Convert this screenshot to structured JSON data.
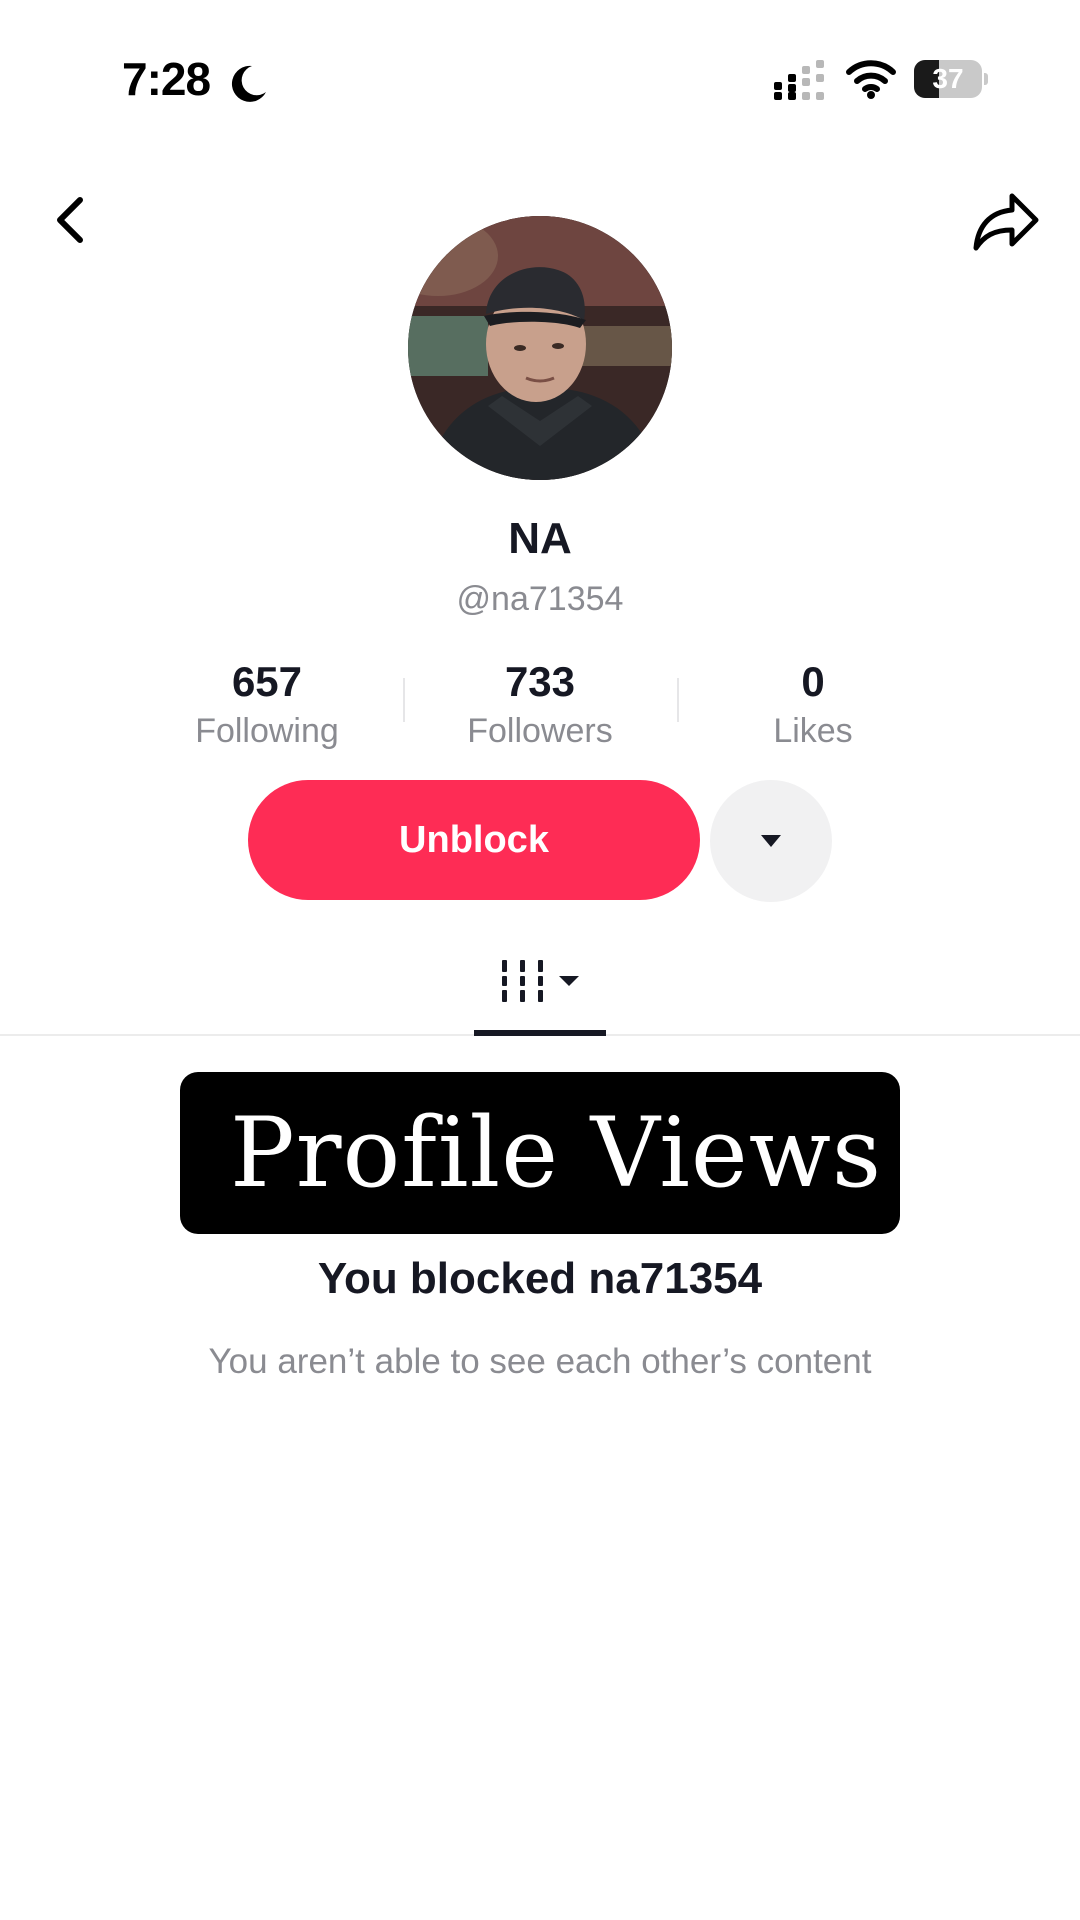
{
  "status_bar": {
    "time": "7:28",
    "battery_percent": "37",
    "battery_level": 0.37,
    "icons": [
      "moon-icon",
      "signal-icon",
      "wifi-icon",
      "battery-icon"
    ]
  },
  "nav": {
    "back_icon": "chevron-left-icon",
    "share_icon": "share-arrow-icon"
  },
  "profile": {
    "display_name": "NA",
    "username": "@na71354"
  },
  "stats": [
    {
      "value": "657",
      "label": "Following"
    },
    {
      "value": "733",
      "label": "Followers"
    },
    {
      "value": "0",
      "label": "Likes"
    }
  ],
  "actions": {
    "unblock_label": "Unblock",
    "more_icon": "caret-down-icon"
  },
  "tabs": {
    "videos_icon": "grid-filter-icon"
  },
  "overlay": {
    "text": "Profile Views"
  },
  "blocked": {
    "title": "You blocked na71354",
    "subtitle": "You aren’t able to see each other’s content"
  },
  "colors": {
    "accent": "#fe2c55",
    "text_primary": "#161823",
    "text_secondary": "#8a8b91",
    "overlay_bg": "#000000"
  }
}
